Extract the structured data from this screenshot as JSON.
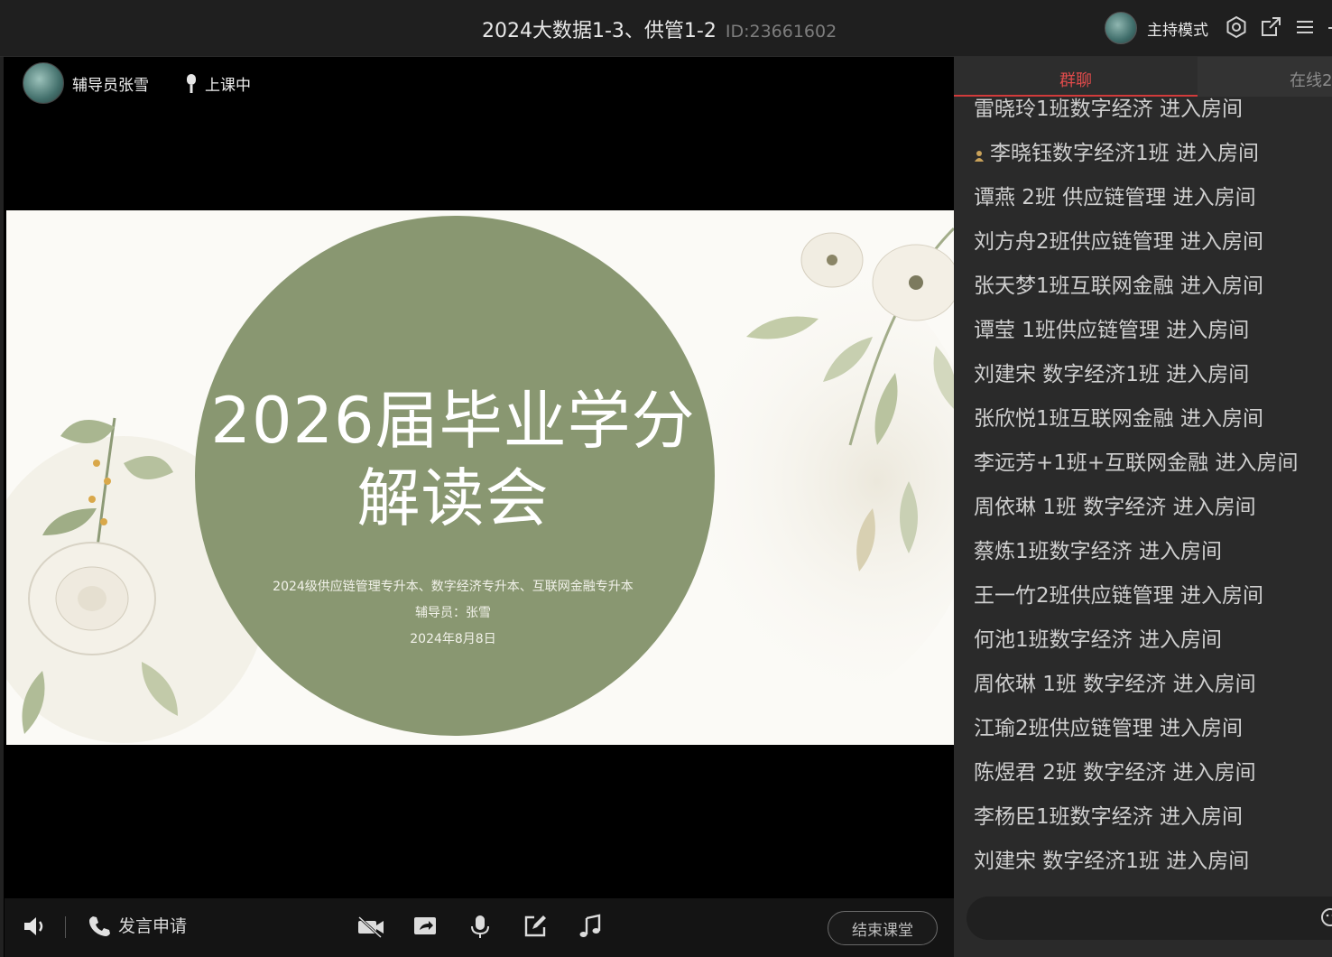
{
  "window": {
    "title": "2024大数据1-3、供管1-2",
    "room_id": "ID:23661602",
    "host_mode_label": "主持模式"
  },
  "stage": {
    "teacher_name": "辅导员张雪",
    "status_label": "上课中"
  },
  "slide": {
    "title_line1": "2026届毕业学分",
    "title_line2": "解读会",
    "subtitle": "2024级供应链管理专升本、数字经济专升本、互联网金融专升本",
    "presenter": "辅导员：张雪",
    "date": "2024年8月8日",
    "circle_color": "#899771"
  },
  "panel": {
    "tabs": [
      {
        "label": "群聊",
        "active": true
      },
      {
        "label": "在线2",
        "active": false
      }
    ],
    "messages": [
      {
        "text": "雷晓玲1班数字经济 进入房间"
      },
      {
        "text": "李晓钰数字经济1班 进入房间",
        "badge": "teacher-badge-icon"
      },
      {
        "text": "谭燕 2班 供应链管理 进入房间"
      },
      {
        "text": "刘方舟2班供应链管理 进入房间"
      },
      {
        "text": "张天梦1班互联网金融 进入房间"
      },
      {
        "text": "谭莹 1班供应链管理 进入房间"
      },
      {
        "text": "刘建宋 数字经济1班 进入房间"
      },
      {
        "text": "张欣悦1班互联网金融 进入房间"
      },
      {
        "text": "李远芳+1班+互联网金融 进入房间"
      },
      {
        "text": "周依琳 1班 数字经济 进入房间"
      },
      {
        "text": "蔡炼1班数字经济 进入房间"
      },
      {
        "text": "王一竹2班供应链管理 进入房间"
      },
      {
        "text": "何池1班数字经济 进入房间"
      },
      {
        "text": "周依琳 1班 数字经济 进入房间"
      },
      {
        "text": "江瑜2班供应链管理 进入房间"
      },
      {
        "text": "陈煜君 2班 数字经济 进入房间"
      },
      {
        "text": "李杨臣1班数字经济 进入房间"
      },
      {
        "text": "刘建宋 数字经济1班 进入房间"
      }
    ]
  },
  "bottombar": {
    "speak_request_label": "发言申请",
    "end_class_label": "结束课堂"
  },
  "colors": {
    "accent_red": "#d13b3b",
    "panel_bg": "#2a2a2a"
  }
}
